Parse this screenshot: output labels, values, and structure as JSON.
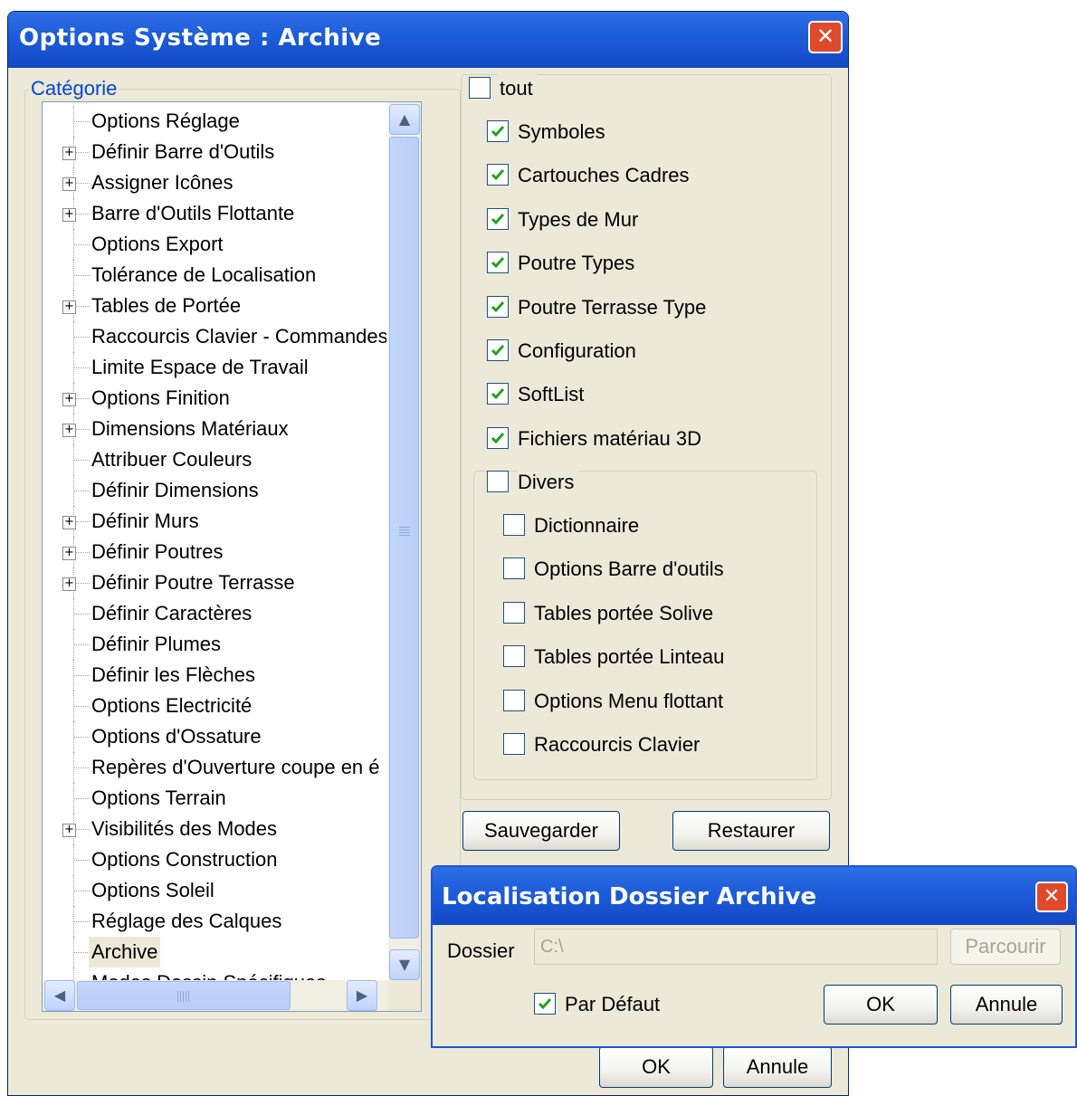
{
  "main_dialog": {
    "title": "Options Système : Archive",
    "close_glyph": "✕",
    "category_legend": "Catégorie",
    "tree_items": [
      {
        "label": "Options Réglage",
        "expandable": false
      },
      {
        "label": "Définir Barre d'Outils",
        "expandable": true
      },
      {
        "label": "Assigner Icônes",
        "expandable": true
      },
      {
        "label": "Barre d'Outils Flottante",
        "expandable": true
      },
      {
        "label": "Options Export",
        "expandable": false
      },
      {
        "label": "Tolérance de Localisation",
        "expandable": false
      },
      {
        "label": "Tables de Portée",
        "expandable": true
      },
      {
        "label": "Raccourcis Clavier - Commandes",
        "expandable": false
      },
      {
        "label": "Limite Espace de Travail",
        "expandable": false
      },
      {
        "label": "Options Finition",
        "expandable": true
      },
      {
        "label": "Dimensions Matériaux",
        "expandable": true
      },
      {
        "label": "Attribuer Couleurs",
        "expandable": false
      },
      {
        "label": "Définir Dimensions",
        "expandable": false
      },
      {
        "label": "Définir Murs",
        "expandable": true
      },
      {
        "label": "Définir Poutres",
        "expandable": true
      },
      {
        "label": "Définir Poutre Terrasse",
        "expandable": true
      },
      {
        "label": "Définir Caractères",
        "expandable": false
      },
      {
        "label": "Définir Plumes",
        "expandable": false
      },
      {
        "label": "Définir les Flèches",
        "expandable": false
      },
      {
        "label": "Options Electricité",
        "expandable": false
      },
      {
        "label": "Options d'Ossature",
        "expandable": false
      },
      {
        "label": "Repères d'Ouverture coupe en é",
        "expandable": false
      },
      {
        "label": "Options Terrain",
        "expandable": false
      },
      {
        "label": "Visibilités des Modes",
        "expandable": true
      },
      {
        "label": "Options Construction",
        "expandable": false
      },
      {
        "label": "Options Soleil",
        "expandable": false
      },
      {
        "label": "Réglage des Calques",
        "expandable": false
      },
      {
        "label": "Archive",
        "expandable": false,
        "selected": true
      },
      {
        "label": "Modes Dessin Spécifiques",
        "expandable": false
      }
    ],
    "scroll_glyphs": {
      "up": "▲",
      "down": "▼",
      "left": "◀",
      "right": "▶"
    },
    "tout": {
      "label": "tout",
      "checked": false
    },
    "checkboxes": [
      {
        "label": "Symboles",
        "checked": true
      },
      {
        "label": "Cartouches Cadres",
        "checked": true
      },
      {
        "label": "Types de Mur",
        "checked": true
      },
      {
        "label": "Poutre Types",
        "checked": true
      },
      {
        "label": "Poutre Terrasse Type",
        "checked": true
      },
      {
        "label": "Configuration",
        "checked": true
      },
      {
        "label": "SoftList",
        "checked": true
      },
      {
        "label": "Fichiers matériau 3D",
        "checked": true
      }
    ],
    "divers": {
      "label": "Divers",
      "checked": false
    },
    "divers_items": [
      {
        "label": "Dictionnaire",
        "checked": false
      },
      {
        "label": "Options Barre d'outils",
        "checked": false
      },
      {
        "label": "Tables portée Solive",
        "checked": false
      },
      {
        "label": "Tables portée Linteau",
        "checked": false
      },
      {
        "label": "Options Menu flottant",
        "checked": false
      },
      {
        "label": "Raccourcis Clavier",
        "checked": false
      }
    ],
    "save_label": "Sauvegarder",
    "restore_label": "Restaurer",
    "ok_label": "OK",
    "cancel_label": "Annule"
  },
  "sub_dialog": {
    "title": "Localisation Dossier Archive",
    "close_glyph": "✕",
    "folder_label": "Dossier",
    "folder_value": "C:\\",
    "browse_label": "Parcourir",
    "default_label": "Par Défaut",
    "default_checked": true,
    "ok_label": "OK",
    "cancel_label": "Annule"
  },
  "colors": {
    "title_bar": "#1d5cd8",
    "dialog_bg": "#ece9d8",
    "close_button": "#e04a2c",
    "check_mark": "#21a121",
    "legend_text": "#0046d5"
  }
}
